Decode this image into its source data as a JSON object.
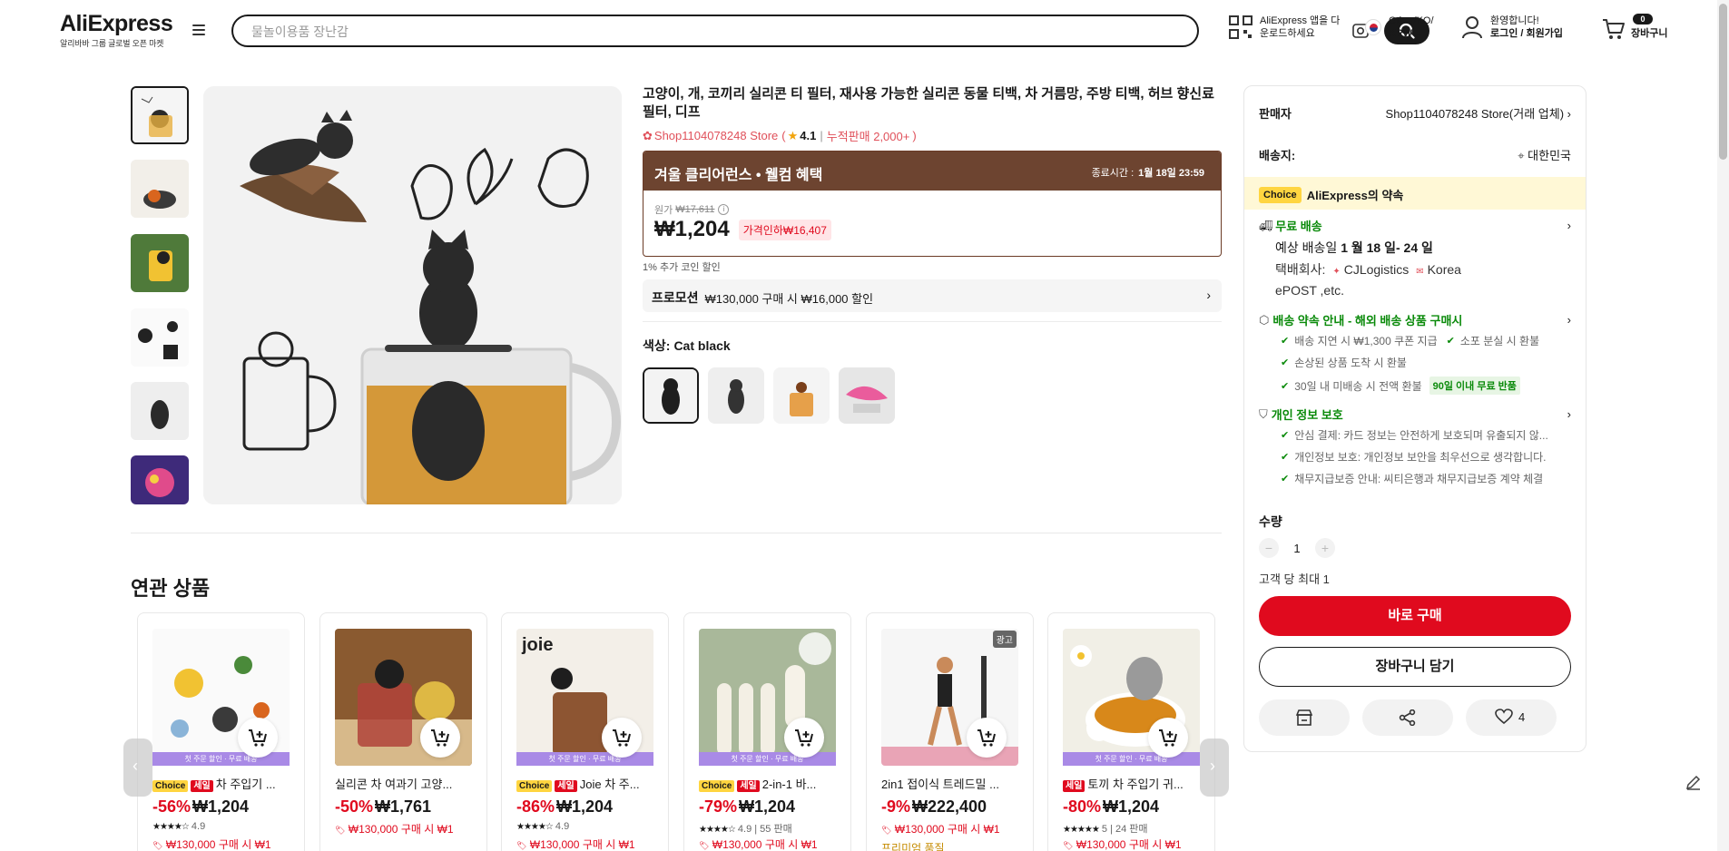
{
  "header": {
    "logo_text": "AliExpress",
    "logo_sub": "알리바바 그룹 글로벌 오픈 마켓",
    "search_placeholder": "물놀이용품 장난감",
    "app_line1": "AliExpress 앱을 다",
    "app_line2": "운로드하세요",
    "locale_line1": "Other/KO/",
    "locale_line2": "KRW",
    "user_line1": "환영합니다!",
    "user_line2": "로그인 / 회원가입",
    "cart_count": "0",
    "cart_label": "장바구니"
  },
  "product": {
    "title": "고양이, 개, 코끼리 실리콘 티 필터, 재사용 가능한 실리콘 동물 티백, 차 거름망, 주방 티백, 허브 향신료 필터, 디프",
    "store_name": "Shop1104078248 Store",
    "rating": "4.1",
    "sold": "누적판매 2,000+",
    "promo_title": "겨울 클리어런스 • 웰컴 혜택",
    "end_label": "종료시간 :",
    "end_time": "1월 18일 23:59",
    "original_label": "원가",
    "original_price": "₩17,611",
    "price": "₩1,204",
    "price_cut": "가격인하₩16,407",
    "coin_text": "1% 추가 코인 할인",
    "promotion_label": "프로모션",
    "promotion_text": "₩130,000 구매 시 ₩16,000 할인",
    "color_label": "색상:",
    "color_value": "Cat black"
  },
  "panel": {
    "seller_label": "판매자",
    "seller_value": "Shop1104078248 Store(거래 업체)",
    "ship_to_label": "배송지:",
    "ship_to_value": "대한민국",
    "choice_tag": "Choice",
    "choice_text": "AliExpress의 약속",
    "free_ship": "무료 배송",
    "eta_prefix": "예상 배송일",
    "eta": "1 월 18 일- 24 일",
    "courier_label": "택배회사:",
    "courier_1": "CJLogistics",
    "courier_2": "Korea",
    "courier_3": "ePOST ,etc.",
    "promise_title": "배송 약속 안내 - 해외 배송 상품 구매시",
    "promise_1": "배송 지연 시 ₩1,300 쿠폰 지급",
    "promise_2": "소포 분실 시 환불",
    "promise_3": "손상된 상품 도착 시 환불",
    "promise_4": "30일 내 미배송 시 전액 환불",
    "promise_badge": "90일 이내 무료 반품",
    "privacy_title": "개인 정보 보호",
    "privacy_1": "안심 결제: 카드 정보는 안전하게 보호되며 유출되지 않...",
    "privacy_2": "개인정보 보호: 개인정보 보안을 최우선으로 생각합니다.",
    "privacy_3": "채무지급보증 안내: 씨티은행과 채무지급보증 계약 체결",
    "qty_label": "수량",
    "qty_value": "1",
    "qty_limit": "고객 당 최대 1",
    "buy_now": "바로 구매",
    "add_cart": "장바구니 담기",
    "wish_count": "4"
  },
  "related": {
    "title": "연관 상품",
    "strip_text": "첫 주문 할인 · 무료 배송",
    "ad_label": "광고",
    "items": [
      {
        "tag_choice": "Choice",
        "tag_sale": "세일",
        "name": "차 주입기 ...",
        "discount": "-56%",
        "price": "₩1,204",
        "stars": "★★★★☆",
        "rating": "4.9",
        "sold": "",
        "deal": "₩130,000 구매 시 ₩1"
      },
      {
        "tag_choice": "",
        "tag_sale": "",
        "name": "실리콘 차 여과기 고양...",
        "discount": "-50%",
        "price": "₩1,761",
        "stars": "",
        "rating": "",
        "sold": "",
        "deal": "₩130,000 구매 시 ₩1"
      },
      {
        "tag_choice": "Choice",
        "tag_sale": "세일",
        "name": "Joie 차 주...",
        "discount": "-86%",
        "price": "₩1,204",
        "stars": "★★★★☆",
        "rating": "4.9",
        "sold": "",
        "deal": "₩130,000 구매 시 ₩1"
      },
      {
        "tag_choice": "Choice",
        "tag_sale": "세일",
        "name": "2-in-1 바...",
        "discount": "-79%",
        "price": "₩1,204",
        "stars": "★★★★☆",
        "rating": "4.9",
        "sold": "55 판매",
        "deal": "₩130,000 구매 시 ₩1"
      },
      {
        "tag_choice": "",
        "tag_sale": "",
        "name": "2in1 접이식 트레드밀 ...",
        "discount": "-9%",
        "price": "₩222,400",
        "stars": "",
        "rating": "",
        "sold": "",
        "deal": "₩130,000 구매 시 ₩1"
      },
      {
        "tag_choice": "",
        "tag_sale": "세일",
        "name": "토끼 차 주입기 귀...",
        "discount": "-80%",
        "price": "₩1,204",
        "stars": "★★★★★",
        "rating": "5",
        "sold": "24 판매",
        "deal": "₩130,000 구매 시 ₩1"
      }
    ],
    "premium_label": "프리미엄 품질"
  },
  "colors": {
    "accent_red": "#e00a1e",
    "promo_brown": "#6d4430",
    "choice_yellow": "#ffd540",
    "green": "#0a8a0a"
  }
}
